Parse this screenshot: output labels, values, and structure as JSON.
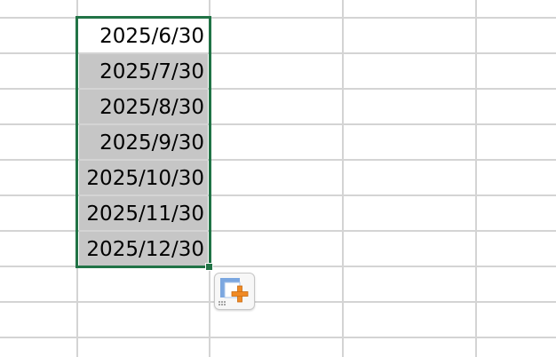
{
  "sheet": {
    "cells": [
      {
        "value": "2025/6/30",
        "selected_fill": false
      },
      {
        "value": "2025/7/30",
        "selected_fill": true
      },
      {
        "value": "2025/8/30",
        "selected_fill": true
      },
      {
        "value": "2025/9/30",
        "selected_fill": true
      },
      {
        "value": "2025/10/30",
        "selected_fill": true
      },
      {
        "value": "2025/11/30",
        "selected_fill": true
      },
      {
        "value": "2025/12/30",
        "selected_fill": true
      }
    ]
  },
  "colors": {
    "selection_border": "#217346",
    "selected_cell_fill": "#c6c6c6",
    "gridline": "#d4d4d4",
    "autofill_plus": "#f08a24",
    "autofill_corner": "#7ba7e0"
  },
  "autofill_options": {
    "icon": "autofill-options-icon"
  }
}
